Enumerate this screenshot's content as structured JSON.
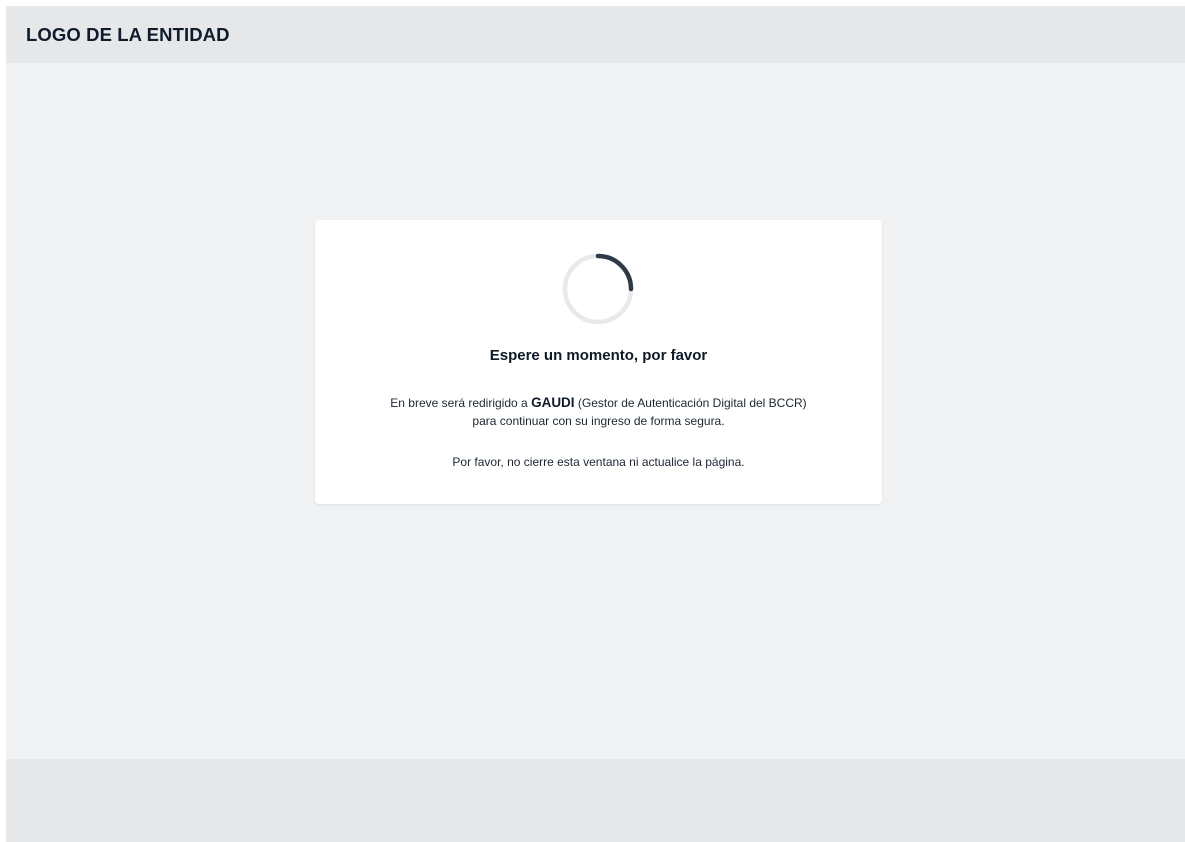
{
  "header": {
    "logo_text": "LOGO DE LA ENTIDAD"
  },
  "card": {
    "spinner_icon": "loading-spinner-icon",
    "title": "Espere un momento, por favor",
    "line1_prefix": "En breve será redirigido a",
    "line1_brand": "GAUDI",
    "line1_suffix": "(Gestor de Autenticación Digital del BCCR)",
    "line2": "para continuar con su ingreso de forma segura.",
    "line3": "Por favor, no cierre esta ventana ni actualice la página."
  },
  "colors": {
    "page_background": "#f1f2f4",
    "header_background": "#e6e7e9",
    "card_background": "#ffffff",
    "spinner_track": "#e8e9eb",
    "spinner_arc": "#2f3a48",
    "text_dark": "#0f1a28"
  }
}
